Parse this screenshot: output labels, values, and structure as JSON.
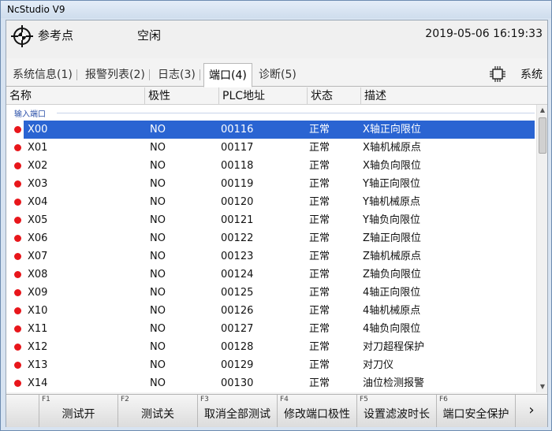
{
  "window": {
    "title": "NcStudio V9"
  },
  "header": {
    "reference_label": "参考点",
    "state_label": "空闲",
    "datetime": "2019-05-06 16:19:33"
  },
  "tabs": [
    {
      "label": "系统信息(1)"
    },
    {
      "label": "报警列表(2)"
    },
    {
      "label": "日志(3)"
    },
    {
      "label": "端口(4)"
    },
    {
      "label": "诊断(5)"
    }
  ],
  "system_button": {
    "label": "系统",
    "icon": "chip-icon"
  },
  "table": {
    "headers": [
      "名称",
      "极性",
      "PLC地址",
      "状态",
      "描述"
    ],
    "group_label": "输入端口",
    "rows": [
      {
        "name": "X00",
        "polarity": "NO",
        "address": "00116",
        "state": "正常",
        "desc": "X轴正向限位"
      },
      {
        "name": "X01",
        "polarity": "NO",
        "address": "00117",
        "state": "正常",
        "desc": "X轴机械原点"
      },
      {
        "name": "X02",
        "polarity": "NO",
        "address": "00118",
        "state": "正常",
        "desc": "X轴负向限位"
      },
      {
        "name": "X03",
        "polarity": "NO",
        "address": "00119",
        "state": "正常",
        "desc": "Y轴正向限位"
      },
      {
        "name": "X04",
        "polarity": "NO",
        "address": "00120",
        "state": "正常",
        "desc": "Y轴机械原点"
      },
      {
        "name": "X05",
        "polarity": "NO",
        "address": "00121",
        "state": "正常",
        "desc": "Y轴负向限位"
      },
      {
        "name": "X06",
        "polarity": "NO",
        "address": "00122",
        "state": "正常",
        "desc": "Z轴正向限位"
      },
      {
        "name": "X07",
        "polarity": "NO",
        "address": "00123",
        "state": "正常",
        "desc": "Z轴机械原点"
      },
      {
        "name": "X08",
        "polarity": "NO",
        "address": "00124",
        "state": "正常",
        "desc": "Z轴负向限位"
      },
      {
        "name": "X09",
        "polarity": "NO",
        "address": "00125",
        "state": "正常",
        "desc": "4轴正向限位"
      },
      {
        "name": "X10",
        "polarity": "NO",
        "address": "00126",
        "state": "正常",
        "desc": "4轴机械原点"
      },
      {
        "name": "X11",
        "polarity": "NO",
        "address": "00127",
        "state": "正常",
        "desc": "4轴负向限位"
      },
      {
        "name": "X12",
        "polarity": "NO",
        "address": "00128",
        "state": "正常",
        "desc": "对刀超程保护"
      },
      {
        "name": "X13",
        "polarity": "NO",
        "address": "00129",
        "state": "正常",
        "desc": "对刀仪"
      },
      {
        "name": "X14",
        "polarity": "NO",
        "address": "00130",
        "state": "正常",
        "desc": "油位检测报警"
      }
    ]
  },
  "fkeys": [
    {
      "key": "F1",
      "label": "测试开"
    },
    {
      "key": "F2",
      "label": "测试关"
    },
    {
      "key": "F3",
      "label": "取消全部测试"
    },
    {
      "key": "F4",
      "label": "修改端口极性"
    },
    {
      "key": "F5",
      "label": "设置滤波时长"
    },
    {
      "key": "F6",
      "label": "端口安全保护"
    }
  ],
  "next_label": "›",
  "colors": {
    "selection": "#2a64d2",
    "status_dot": "#e8161b",
    "group_label": "#2a4fa8"
  }
}
